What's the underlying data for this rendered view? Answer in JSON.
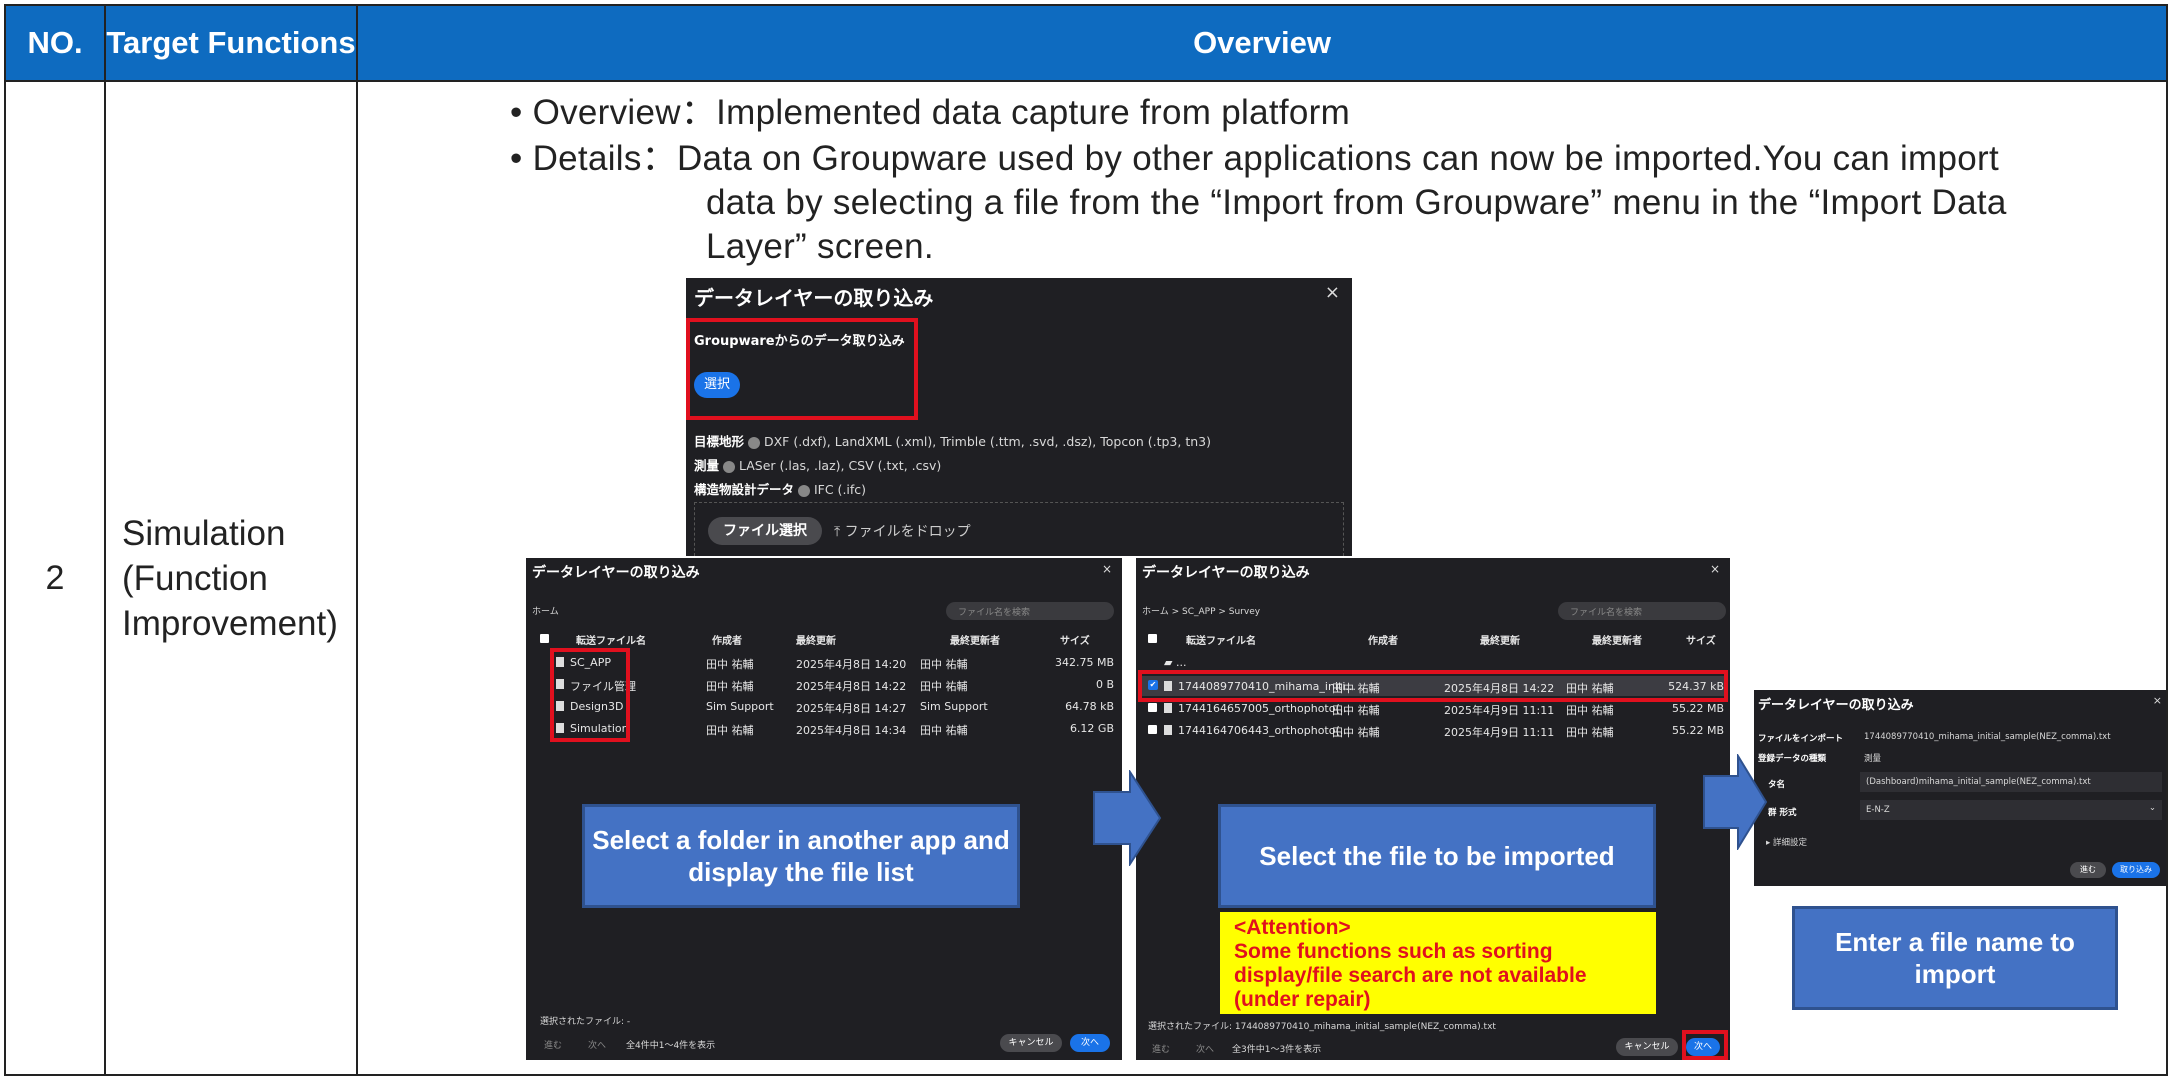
{
  "header": {
    "no": "NO.",
    "target": "Target Functions",
    "overview": "Overview"
  },
  "row": {
    "no": "2",
    "function": "Simulation\n(Function\nImprovement)"
  },
  "bullets": {
    "b1": "• Overview：Implemented data capture from platform",
    "b2": "• Details：Data on Groupware used by other applications can now be imported.You can import",
    "b2c1": "data by selecting a file from the “Import from Groupware” menu in the “Import Data",
    "b2c2": "Layer” screen."
  },
  "dialog1": {
    "title": "データレイヤーの取り込み",
    "close": "×",
    "groupware_label": "Groupwareからのデータ取り込み",
    "select_button": "選択",
    "lines": [
      {
        "label": "目標地形",
        "text": "DXF (.dxf), LandXML (.xml), Trimble (.ttm, .svd, .dsz), Topcon (.tp3, tn3)"
      },
      {
        "label": "測量",
        "text": "LASer (.las, .laz), CSV (.txt, .csv)"
      },
      {
        "label": "構造物設計データ",
        "text": "IFC (.ifc)"
      }
    ],
    "file_select": "ファイル選択",
    "drop": "ファイルをドロップ"
  },
  "dialog2": {
    "title": "データレイヤーの取り込み",
    "close": "×",
    "breadcrumb": "ホーム",
    "search_placeholder": "ファイル名を検索",
    "columns": [
      "転送ファイル名",
      "作成者",
      "最終更新",
      "最終更新者",
      "サイズ"
    ],
    "rows": [
      [
        "SC_APP",
        "田中 祐輔",
        "2025年4月8日 14:20",
        "田中 祐輔",
        "342.75 MB"
      ],
      [
        "ファイル管理",
        "田中 祐輔",
        "2025年4月8日 14:22",
        "田中 祐輔",
        "0 B"
      ],
      [
        "Design3D",
        "Sim Support",
        "2025年4月8日 14:27",
        "Sim Support",
        "64.78 kB"
      ],
      [
        "Simulation",
        "田中 祐輔",
        "2025年4月8日 14:34",
        "田中 祐輔",
        "6.12 GB"
      ]
    ],
    "selected": "選択されたファイル: -",
    "prev": "進む",
    "next_nav": "次へ",
    "count": "全4件中1〜4件を表示",
    "cancel": "キャンセル",
    "next": "次へ"
  },
  "dialog3": {
    "title": "データレイヤーの取り込み",
    "close": "×",
    "breadcrumb": "ホーム > SC_APP > Survey",
    "search_placeholder": "ファイル名を検索",
    "columns": [
      "転送ファイル名",
      "作成者",
      "最終更新",
      "最終更新者",
      "サイズ"
    ],
    "parent": "...",
    "rows": [
      [
        "1744089770410_mihama_initi...",
        "田中 祐輔",
        "2025年4月8日 14:22",
        "田中 祐輔",
        "524.37 kB"
      ],
      [
        "1744164657005_orthophoto(...",
        "田中 祐輔",
        "2025年4月9日 11:11",
        "田中 祐輔",
        "55.22 MB"
      ],
      [
        "1744164706443_orthophoto(...",
        "田中 祐輔",
        "2025年4月9日 11:11",
        "田中 祐輔",
        "55.22 MB"
      ]
    ],
    "selected": "選択されたファイル: 1744089770410_mihama_initial_sample(NEZ_comma).txt",
    "prev": "進む",
    "next_nav": "次へ",
    "count": "全3件中1〜3件を表示",
    "cancel": "キャンセル",
    "next": "次へ"
  },
  "dialog4": {
    "title": "データレイヤーの取り込み",
    "close": "×",
    "import_label": "ファイルをインポート",
    "import_value": "1744089770410_mihama_initial_sample(NEZ_comma).txt",
    "type_label": "登録データの種類",
    "type_value": "測量",
    "name_label": "タ名",
    "name_value": "(Dashboard)mihama_initial_sample(NEZ_comma).txt",
    "format_label": "群 形式",
    "format_value": "E-N-Z",
    "advanced": "▸ 詳細設定",
    "back": "進む",
    "import_button": "取り込み"
  },
  "callouts": {
    "c1": "Select a folder in another app and display the file list",
    "c2": "Select the file to be imported",
    "c3": "Enter a file name to import",
    "attention_title": "<Attention>",
    "attention_body": "Some functions such as sorting display/file search are not available (under repair)"
  },
  "colors": {
    "header_bg": "#0e6bc0",
    "callout_bg": "#4472c4",
    "highlight": "#e0101e",
    "attention_bg": "#ffff00",
    "dialog_bg": "#1f1f23",
    "primary_btn": "#1a73e8"
  }
}
